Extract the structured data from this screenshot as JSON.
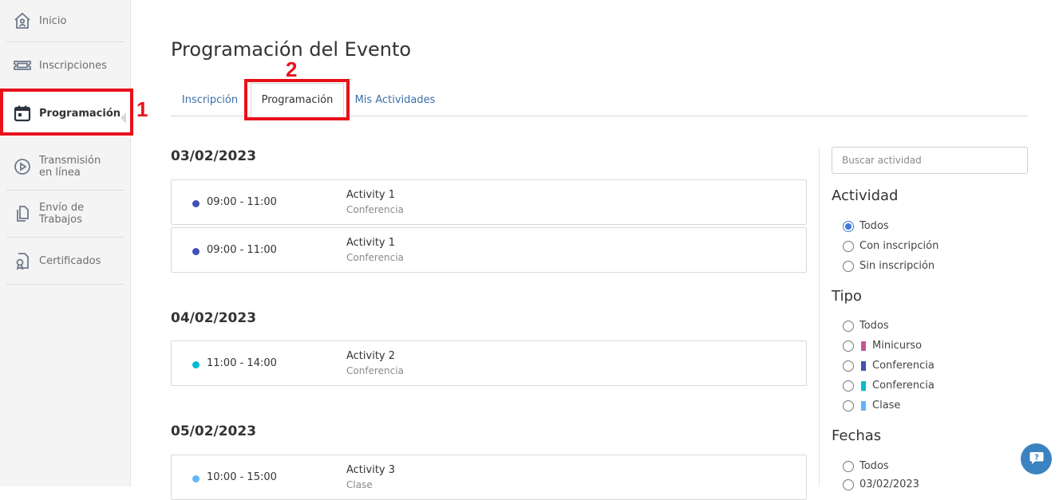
{
  "sidebar": {
    "items": [
      {
        "label": "Inicio",
        "icon": "home-icon"
      },
      {
        "label": "Inscripciones",
        "icon": "ticket-icon"
      },
      {
        "label": "Programación",
        "icon": "calendar-icon"
      },
      {
        "label": "Transmisión\nen línea",
        "icon": "play-icon"
      },
      {
        "label": "Envío de Trabajos",
        "icon": "documents-icon"
      },
      {
        "label": "Certificados",
        "icon": "certificate-icon"
      }
    ]
  },
  "annotations": {
    "one": "1",
    "two": "2"
  },
  "page": {
    "title": "Programación del Evento"
  },
  "tabs": [
    {
      "label": "Inscripción"
    },
    {
      "label": "Programación"
    },
    {
      "label": "Mis Actividades"
    }
  ],
  "schedule": {
    "days": [
      {
        "date": "03/02/2023",
        "items": [
          {
            "time": "09:00 - 11:00",
            "activity": "Activity 1",
            "type": "Conferencia",
            "color": "#3f51b5"
          },
          {
            "time": "09:00 - 11:00",
            "activity": "Activity 1",
            "type": "Conferencia",
            "color": "#3f51b5"
          }
        ]
      },
      {
        "date": "04/02/2023",
        "items": [
          {
            "time": "11:00 - 14:00",
            "activity": "Activity 2",
            "type": "Conferencia",
            "color": "#00bcd4"
          }
        ]
      },
      {
        "date": "05/02/2023",
        "items": [
          {
            "time": "10:00 - 15:00",
            "activity": "Activity 3",
            "type": "Clase",
            "color": "#64b5f6"
          }
        ]
      }
    ]
  },
  "filters": {
    "search_placeholder": "Buscar actividad",
    "actividad": {
      "heading": "Actividad",
      "options": [
        "Todos",
        "Con inscripción",
        "Sin inscripción"
      ]
    },
    "tipo": {
      "heading": "Tipo",
      "options": [
        {
          "label": "Todos",
          "color": ""
        },
        {
          "label": "Minicurso",
          "color": "#c2559b"
        },
        {
          "label": "Conferencia",
          "color": "#3f51b5"
        },
        {
          "label": "Conferencia",
          "color": "#00bcd4"
        },
        {
          "label": "Clase",
          "color": "#64b5f6"
        }
      ]
    },
    "fechas": {
      "heading": "Fechas",
      "options": [
        "Todos",
        "03/02/2023"
      ]
    }
  },
  "colors": {
    "accent": "#3d7ad6",
    "highlight": "#e8111b",
    "link": "#3a6fa8",
    "help_button": "#3b83c0"
  }
}
